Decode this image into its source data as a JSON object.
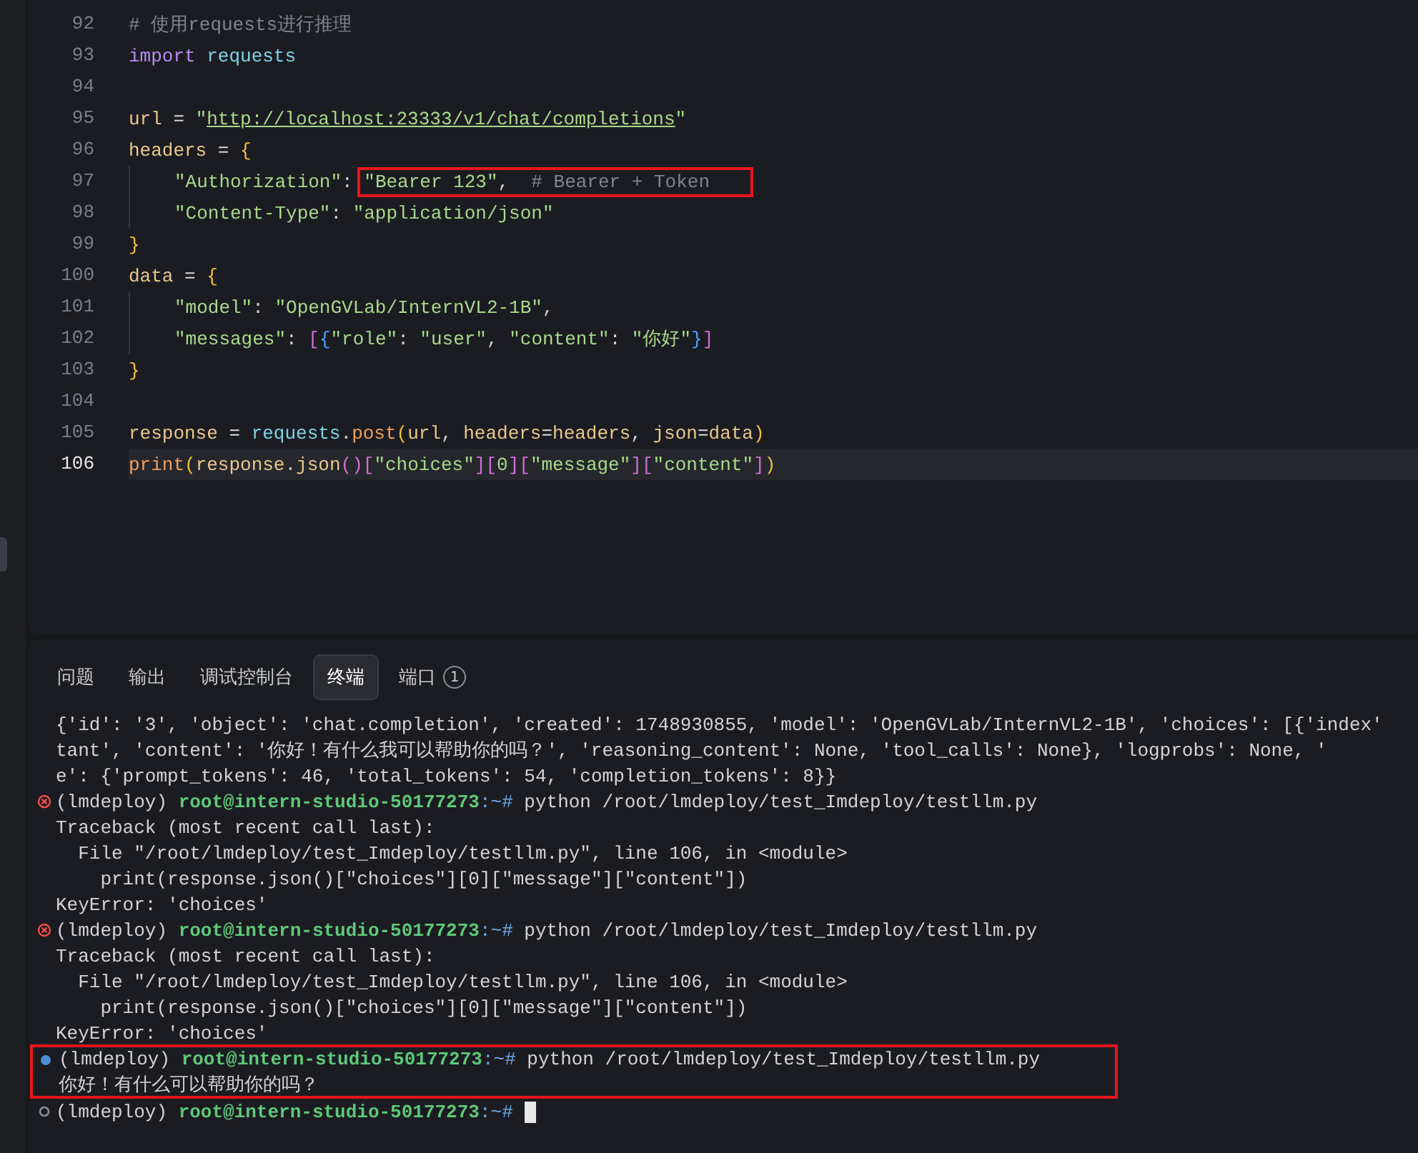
{
  "editor": {
    "lines": [
      {
        "number": "92",
        "current": false,
        "indent": false,
        "tokens": [
          {
            "kind": "comment",
            "text": "# 使用requests进行推理"
          }
        ]
      },
      {
        "number": "93",
        "current": false,
        "indent": false,
        "tokens": [
          {
            "kind": "keyword",
            "text": "import "
          },
          {
            "kind": "module",
            "text": "requests"
          }
        ]
      },
      {
        "number": "94",
        "current": false,
        "indent": false
      },
      {
        "number": "95",
        "current": false,
        "indent": false,
        "tokens": [
          {
            "kind": "var",
            "text": "url"
          },
          {
            "kind": "plain",
            "text": " = "
          },
          {
            "kind": "string",
            "text": "\""
          },
          {
            "kind": "link",
            "text": "http://localhost:23333/v1/chat/completions"
          },
          {
            "kind": "string",
            "text": "\""
          }
        ]
      },
      {
        "number": "96",
        "current": false,
        "indent": false,
        "tokens": [
          {
            "kind": "var",
            "text": "headers"
          },
          {
            "kind": "plain",
            "text": " = "
          },
          {
            "kind": "brace",
            "text": "{"
          }
        ]
      },
      {
        "number": "97",
        "current": false,
        "indent": true,
        "tokens": [
          {
            "kind": "string",
            "text": "\"Authorization\""
          },
          {
            "kind": "plain",
            "text": ": "
          }
        ],
        "boxed_tokens": [
          {
            "kind": "string",
            "text": "\"Bearer 123\""
          },
          {
            "kind": "plain",
            "text": ",  "
          },
          {
            "kind": "comment",
            "text": "# Bearer + Token"
          }
        ]
      },
      {
        "number": "98",
        "current": false,
        "indent": true,
        "tokens": [
          {
            "kind": "string",
            "text": "\"Content-Type\""
          },
          {
            "kind": "plain",
            "text": ": "
          },
          {
            "kind": "string",
            "text": "\"application/json\""
          }
        ]
      },
      {
        "number": "99",
        "current": false,
        "indent": false,
        "tokens": [
          {
            "kind": "brace",
            "text": "}"
          }
        ]
      },
      {
        "number": "100",
        "current": false,
        "indent": false,
        "tokens": [
          {
            "kind": "var",
            "text": "data"
          },
          {
            "kind": "plain",
            "text": " = "
          },
          {
            "kind": "brace",
            "text": "{"
          }
        ]
      },
      {
        "number": "101",
        "current": false,
        "indent": true,
        "tokens": [
          {
            "kind": "string",
            "text": "\"model\""
          },
          {
            "kind": "plain",
            "text": ": "
          },
          {
            "kind": "string",
            "text": "\"OpenGVLab/InternVL2-1B\""
          },
          {
            "kind": "plain",
            "text": ","
          }
        ]
      },
      {
        "number": "102",
        "current": false,
        "indent": true,
        "tokens": [
          {
            "kind": "string",
            "text": "\"messages\""
          },
          {
            "kind": "plain",
            "text": ": "
          },
          {
            "kind": "bracket",
            "text": "["
          },
          {
            "kind": "brace2",
            "text": "{"
          },
          {
            "kind": "string",
            "text": "\"role\""
          },
          {
            "kind": "plain",
            "text": ": "
          },
          {
            "kind": "string",
            "text": "\"user\""
          },
          {
            "kind": "plain",
            "text": ", "
          },
          {
            "kind": "string",
            "text": "\"content\""
          },
          {
            "kind": "plain",
            "text": ": "
          },
          {
            "kind": "string",
            "text": "\"你好\""
          },
          {
            "kind": "brace2",
            "text": "}"
          },
          {
            "kind": "bracket",
            "text": "]"
          }
        ]
      },
      {
        "number": "103",
        "current": false,
        "indent": false,
        "tokens": [
          {
            "kind": "brace",
            "text": "}"
          }
        ]
      },
      {
        "number": "104",
        "current": false,
        "indent": false
      },
      {
        "number": "105",
        "current": false,
        "indent": false,
        "tokens": [
          {
            "kind": "var",
            "text": "response"
          },
          {
            "kind": "plain",
            "text": " = "
          },
          {
            "kind": "module",
            "text": "requests"
          },
          {
            "kind": "plain",
            "text": "."
          },
          {
            "kind": "func",
            "text": "post"
          },
          {
            "kind": "brace",
            "text": "("
          },
          {
            "kind": "var",
            "text": "url"
          },
          {
            "kind": "plain",
            "text": ", "
          },
          {
            "kind": "var",
            "text": "headers"
          },
          {
            "kind": "plain",
            "text": "="
          },
          {
            "kind": "var",
            "text": "headers"
          },
          {
            "kind": "plain",
            "text": ", "
          },
          {
            "kind": "var",
            "text": "json"
          },
          {
            "kind": "plain",
            "text": "="
          },
          {
            "kind": "var",
            "text": "data"
          },
          {
            "kind": "brace",
            "text": ")"
          }
        ]
      },
      {
        "number": "106",
        "current": true,
        "indent": false,
        "tokens": [
          {
            "kind": "func",
            "text": "print"
          },
          {
            "kind": "brace",
            "text": "("
          },
          {
            "kind": "var",
            "text": "response"
          },
          {
            "kind": "plain",
            "text": "."
          },
          {
            "kind": "var",
            "text": "json"
          },
          {
            "kind": "bracket",
            "text": "()"
          },
          {
            "kind": "bracket",
            "text": "["
          },
          {
            "kind": "string",
            "text": "\"choices\""
          },
          {
            "kind": "bracket",
            "text": "]["
          },
          {
            "kind": "string",
            "text": "0"
          },
          {
            "kind": "bracket",
            "text": "]["
          },
          {
            "kind": "string",
            "text": "\"message\""
          },
          {
            "kind": "bracket",
            "text": "]["
          },
          {
            "kind": "string",
            "text": "\"content\""
          },
          {
            "kind": "bracket",
            "text": "]"
          },
          {
            "kind": "brace",
            "text": ")"
          }
        ]
      }
    ]
  },
  "panel": {
    "tabs": [
      {
        "label": "问题",
        "selected": false
      },
      {
        "label": "输出",
        "selected": false
      },
      {
        "label": "调试控制台",
        "selected": false
      },
      {
        "label": "终端",
        "selected": true
      },
      {
        "label": "端口",
        "selected": false,
        "badge": "1"
      }
    ],
    "terminal": [
      {
        "kind": "output",
        "annotated": false,
        "text": "{'id': '3', 'object': 'chat.completion', 'created': 1748930855, 'model': 'OpenGVLab/InternVL2-1B', 'choices': [{'index'"
      },
      {
        "kind": "output",
        "annotated": false,
        "text": "tant', 'content': '你好！有什么我可以帮助你的吗？', 'reasoning_content': None, 'tool_calls': None}, 'logprobs': None, '"
      },
      {
        "kind": "output",
        "annotated": false,
        "text": "e': {'prompt_tokens': 46, 'total_tokens': 54, 'completion_tokens': 8}}"
      },
      {
        "kind": "prompt_error",
        "annotated": false,
        "env": "(lmdeploy)",
        "user": "root@intern-studio-50177273",
        "path": ":~#",
        "command": "python /root/lmdeploy/test_Imdeploy/testllm.py",
        "cursor": false
      },
      {
        "kind": "output",
        "annotated": false,
        "text": "Traceback (most recent call last):"
      },
      {
        "kind": "output",
        "annotated": false,
        "text": "  File \"/root/lmdeploy/test_Imdeploy/testllm.py\", line 106, in <module>"
      },
      {
        "kind": "output",
        "annotated": false,
        "text": "    print(response.json()[\"choices\"][0][\"message\"][\"content\"])"
      },
      {
        "kind": "output",
        "annotated": false,
        "text": "KeyError: 'choices'"
      },
      {
        "kind": "prompt_error",
        "annotated": false,
        "env": "(lmdeploy)",
        "user": "root@intern-studio-50177273",
        "path": ":~#",
        "command": "python /root/lmdeploy/test_Imdeploy/testllm.py",
        "cursor": false
      },
      {
        "kind": "output",
        "annotated": false,
        "text": "Traceback (most recent call last):"
      },
      {
        "kind": "output",
        "annotated": false,
        "text": "  File \"/root/lmdeploy/test_Imdeploy/testllm.py\", line 106, in <module>"
      },
      {
        "kind": "output",
        "annotated": false,
        "text": "    print(response.json()[\"choices\"][0][\"message\"][\"content\"])"
      },
      {
        "kind": "output",
        "annotated": false,
        "text": "KeyError: 'choices'"
      },
      {
        "kind": "prompt_success",
        "annotated": true,
        "env": "(lmdeploy)",
        "user": "root@intern-studio-50177273",
        "path": ":~#",
        "command": "python /root/lmdeploy/test_Imdeploy/testllm.py",
        "cursor": false
      },
      {
        "kind": "output",
        "annotated": true,
        "text": "你好！有什么可以帮助你的吗？"
      },
      {
        "kind": "prompt_idle",
        "annotated": false,
        "env": "(lmdeploy)",
        "user": "root@intern-studio-50177273",
        "path": ":~#",
        "cursor": true
      }
    ]
  }
}
